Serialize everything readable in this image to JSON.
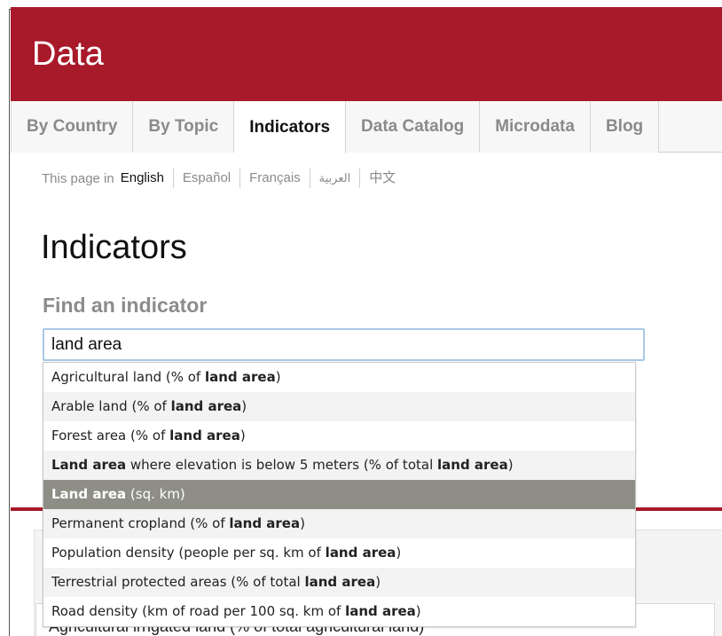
{
  "header": {
    "title": "Data",
    "brand_color": "#a8192a"
  },
  "nav": {
    "tabs": [
      {
        "label": "By Country",
        "active": false
      },
      {
        "label": "By Topic",
        "active": false
      },
      {
        "label": "Indicators",
        "active": true
      },
      {
        "label": "Data Catalog",
        "active": false
      },
      {
        "label": "Microdata",
        "active": false
      },
      {
        "label": "Blog",
        "active": false
      }
    ]
  },
  "languages": {
    "prefix": "This page in",
    "items": [
      {
        "label": "English",
        "current": true
      },
      {
        "label": "Español",
        "current": false
      },
      {
        "label": "Français",
        "current": false
      },
      {
        "label": "العربية",
        "current": false
      },
      {
        "label": "中文",
        "current": false
      }
    ]
  },
  "page": {
    "title": "Indicators"
  },
  "search": {
    "label": "Find an indicator",
    "value": "land area",
    "focus_color": "#a9c8e6"
  },
  "suggestions": {
    "highlight_color": "#8e8e86",
    "items": [
      {
        "parts": [
          {
            "t": "Agricultural land (% of "
          },
          {
            "t": "land area",
            "b": true
          },
          {
            "t": ")"
          }
        ],
        "selected": false
      },
      {
        "parts": [
          {
            "t": "Arable land (% of "
          },
          {
            "t": "land area",
            "b": true
          },
          {
            "t": ")"
          }
        ],
        "selected": false
      },
      {
        "parts": [
          {
            "t": "Forest area (% of "
          },
          {
            "t": "land area",
            "b": true
          },
          {
            "t": ")"
          }
        ],
        "selected": false
      },
      {
        "parts": [
          {
            "t": "Land area",
            "b": true
          },
          {
            "t": " where elevation is below 5 meters (% of total "
          },
          {
            "t": "land area",
            "b": true
          },
          {
            "t": ")"
          }
        ],
        "selected": false
      },
      {
        "parts": [
          {
            "t": "Land area",
            "b": true
          },
          {
            "t": " (sq. km)"
          }
        ],
        "selected": true
      },
      {
        "parts": [
          {
            "t": "Permanent cropland (% of "
          },
          {
            "t": "land area",
            "b": true
          },
          {
            "t": ")"
          }
        ],
        "selected": false
      },
      {
        "parts": [
          {
            "t": "Population density (people per sq. km of "
          },
          {
            "t": "land area",
            "b": true
          },
          {
            "t": ")"
          }
        ],
        "selected": false
      },
      {
        "parts": [
          {
            "t": "Terrestrial protected areas (% of total "
          },
          {
            "t": "land area",
            "b": true
          },
          {
            "t": ")"
          }
        ],
        "selected": false
      },
      {
        "parts": [
          {
            "t": "Road density (km of road per 100 sq. km of "
          },
          {
            "t": "land area",
            "b": true
          },
          {
            "t": ")"
          }
        ],
        "selected": false
      }
    ]
  },
  "background_list": {
    "partial_item": "Agricultural irrigated land (% of total agricultural land)"
  }
}
